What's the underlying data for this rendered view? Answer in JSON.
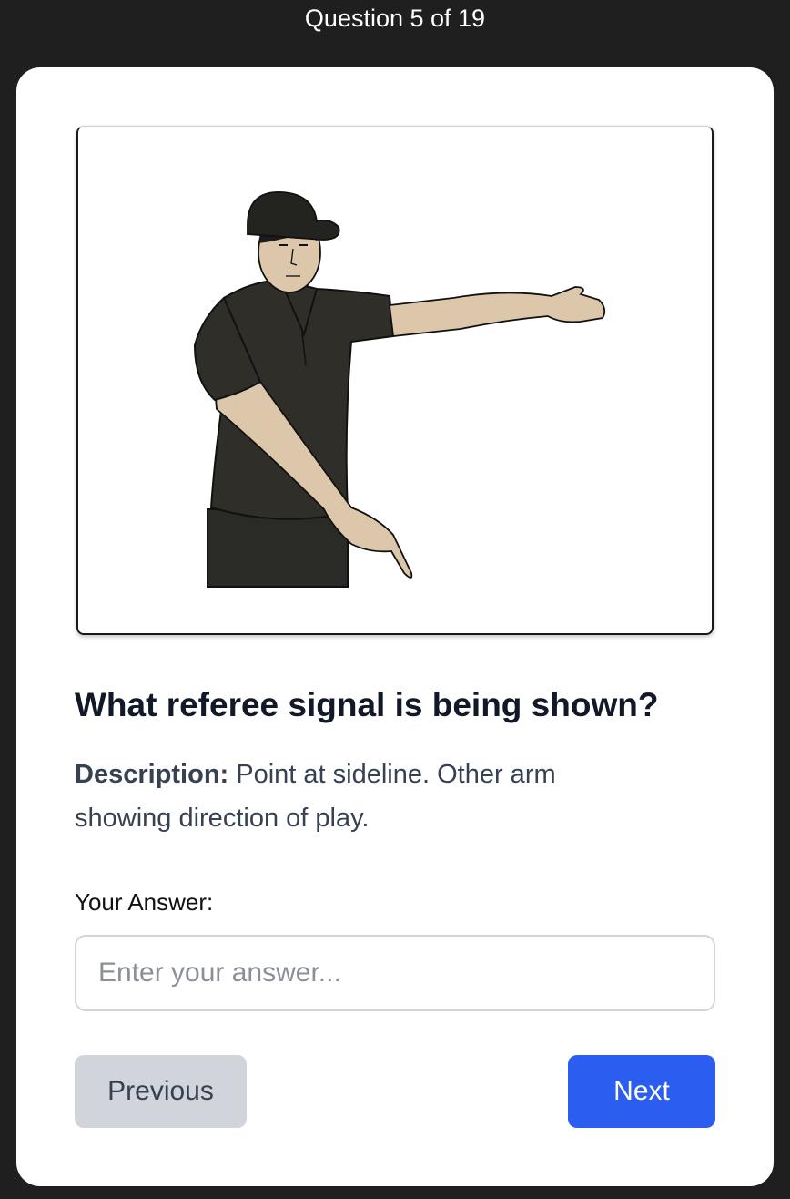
{
  "header": {
    "progress_text": "Question 5 of 19"
  },
  "image": {
    "subject_icon": "referee-signal-figure"
  },
  "question": {
    "text": "What referee signal is being shown?",
    "description_label": "Description:",
    "description_text": " Point at sideline. Other arm showing direction of play."
  },
  "answer": {
    "label": "Your Answer:",
    "value": "",
    "placeholder": "Enter your answer..."
  },
  "nav": {
    "previous_label": "Previous",
    "next_label": "Next"
  },
  "colors": {
    "background": "#1f1f1f",
    "card": "#ffffff",
    "primary_button": "#2b5ef0",
    "secondary_button": "#d1d5db"
  }
}
